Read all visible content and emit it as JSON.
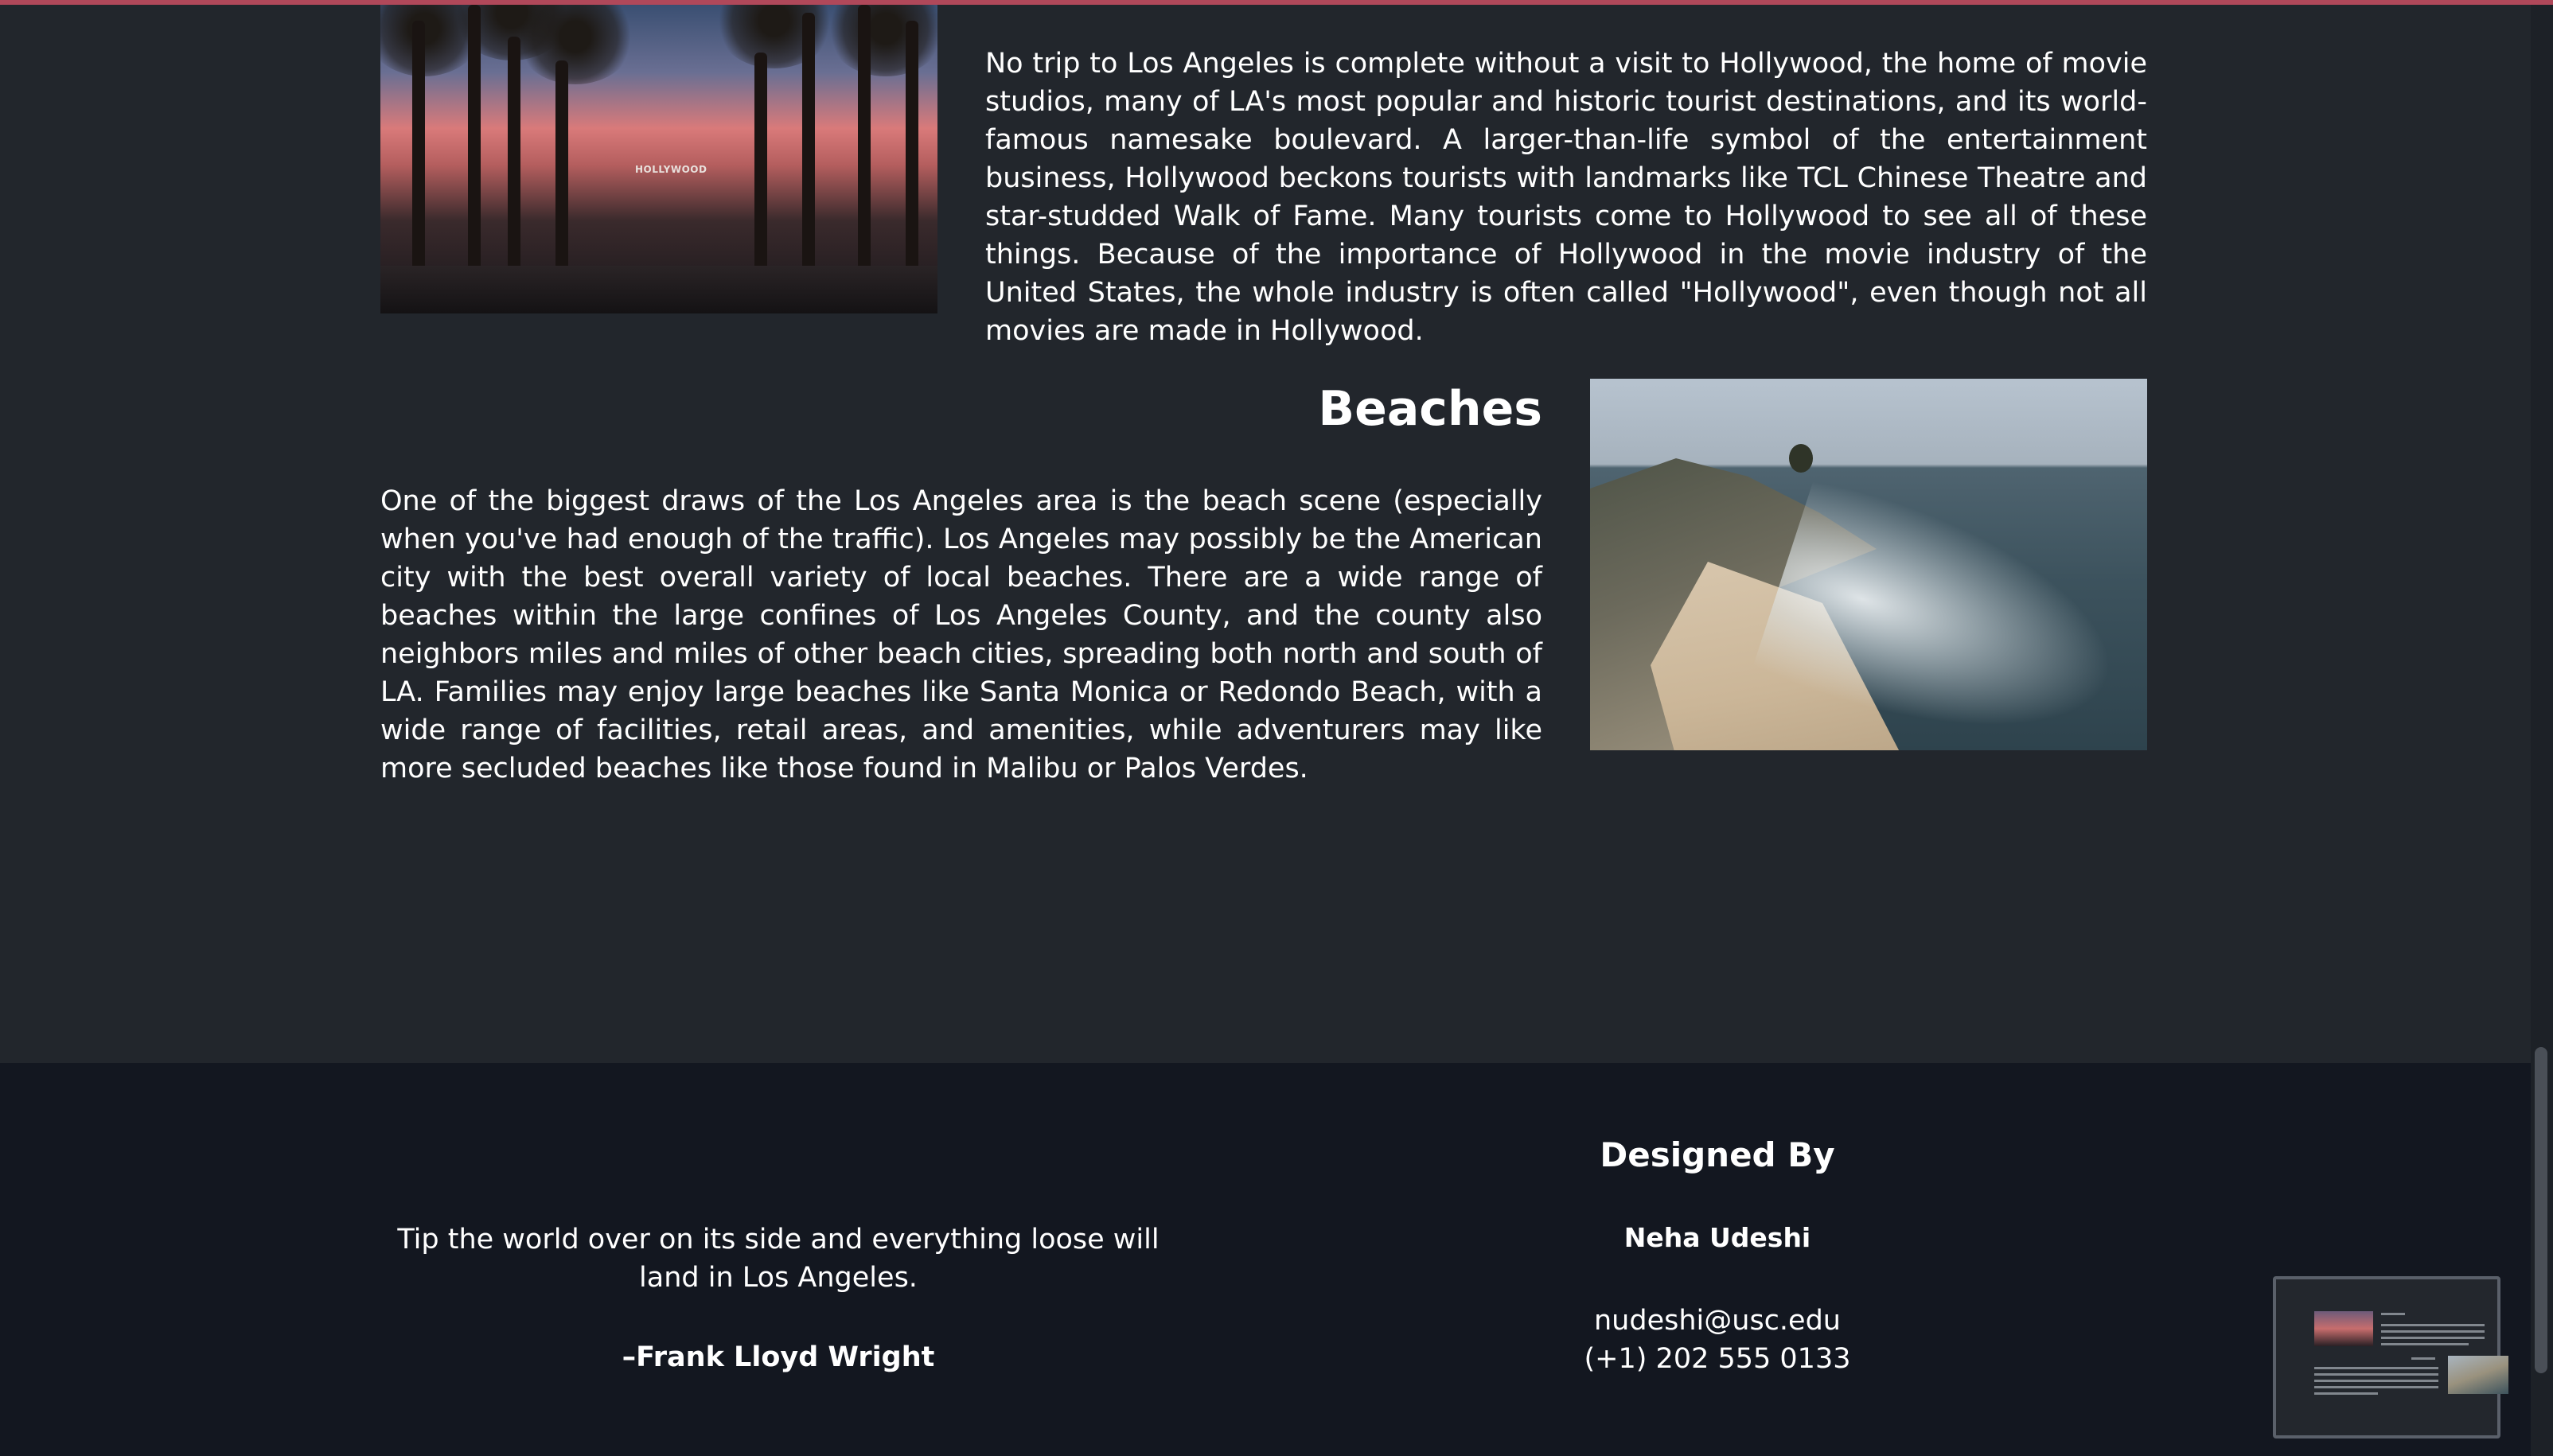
{
  "sections": {
    "hollywood": {
      "image_alt": "Hollywood street lined with palm trees at sunset",
      "sign_text": "HOLLYWOOD",
      "body": "No trip to Los Angeles is complete without a visit to Hollywood, the home of movie studios, many of LA's most popular and historic tourist destinations, and its world-famous namesake boulevard. A larger-than-life symbol of the entertainment business, Hollywood beckons tourists with landmarks like TCL Chinese Theatre and star-studded Walk of Fame. Many tourists come to Hollywood to see all of these things. Because of the importance of Hollywood in the movie industry of the United States, the whole industry is often called \"Hollywood\", even though not all movies are made in Hollywood."
    },
    "beaches": {
      "heading": "Beaches",
      "body": "One of the biggest draws of the Los Angeles area is the beach scene (especially when you've had enough of the traffic). Los Angeles may possibly be the American city with the best overall variety of local beaches. There are a wide range of beaches within the large confines of Los Angeles County, and the county also neighbors miles and miles of other beach cities, spreading both north and south of LA. Families may enjoy large beaches like Santa Monica or Redondo Beach, with a wide range of facilities, retail areas, and amenities, while adventurers may like more secluded beaches like those found in Malibu or Palos Verdes.",
      "image_alt": "Rocky coastline with a sandy cove and waves"
    }
  },
  "footer": {
    "quote": "Tip the world over on its side and everything loose will land in Los Angeles.",
    "quote_author": "–Frank Lloyd Wright",
    "designed_heading": "Designed By",
    "designer_name": "Neha Udeshi",
    "email": "nudeshi@usc.edu",
    "phone": "(+1) 202 555 0133"
  },
  "colors": {
    "page_background": "#22262c",
    "footer_background": "#131720",
    "top_accent": "#b0485a",
    "text": "#ffffff"
  }
}
